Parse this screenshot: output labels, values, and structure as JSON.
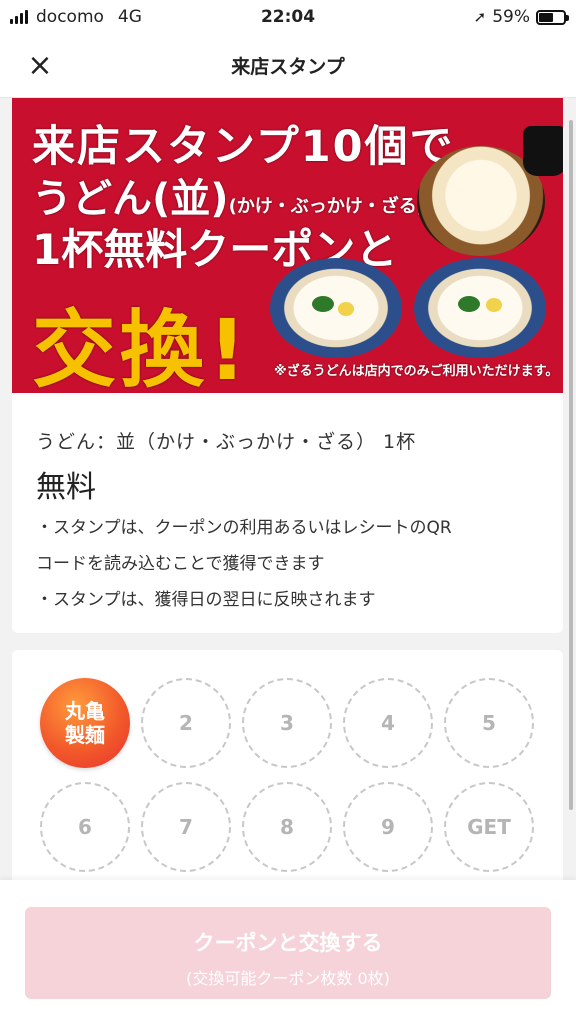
{
  "status_bar": {
    "carrier": "docomo",
    "network": "4G",
    "time": "22:04",
    "battery": "59%",
    "battery_level": 0.59
  },
  "header": {
    "close_icon": "×",
    "title": "来店スタンプ"
  },
  "banner": {
    "line1": "来店スタンプ10個で",
    "line2_main": "うどん(並)",
    "line2_sub": "(かけ・ぶっかけ・ざる)",
    "line3": "1杯無料クーポンと",
    "line4": "交換!",
    "footnote": "※ざるうどんは店内でのみご利用いただけます。",
    "colors": {
      "background": "#c8102e",
      "accent": "#f6c200"
    }
  },
  "info": {
    "menu": "うどん：並（かけ・ぶっかけ・ざる） 1杯",
    "price": "無料",
    "note1": "・スタンプは、クーポンの利用あるいはレシートのQR",
    "note1b": "コードを読み込むことで獲得できます",
    "note2": "・スタンプは、獲得日の翌日に反映されます"
  },
  "stamps": {
    "filled_label_1": "丸亀",
    "filled_label_2": "製麺",
    "slots": [
      "2",
      "3",
      "4",
      "5",
      "6",
      "7",
      "8",
      "9",
      "GET"
    ],
    "collected": 1,
    "total": 10
  },
  "bottom": {
    "button_label": "クーポンと交換する",
    "button_sub": "(交換可能クーポン枚数 0枚)",
    "button_color": "#f5d3d8"
  }
}
